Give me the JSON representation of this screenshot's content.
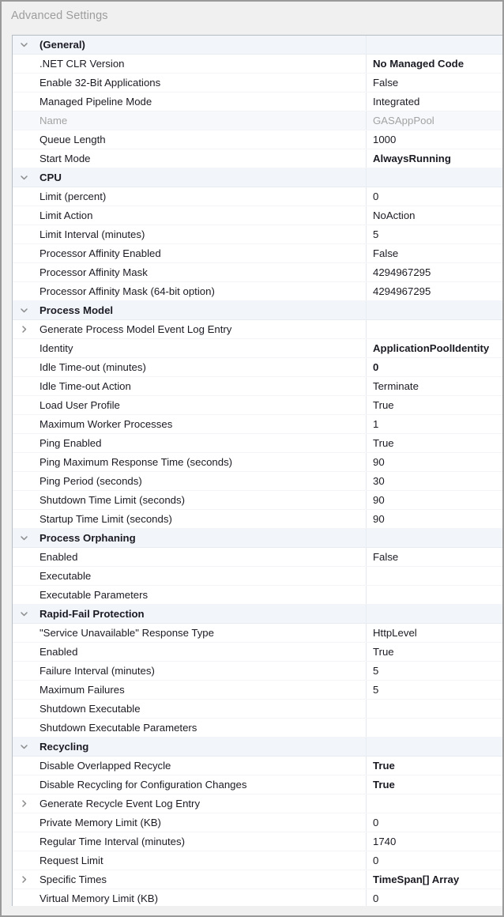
{
  "window": {
    "title": "Advanced Settings"
  },
  "icons": {
    "expanded": "chevron-down-icon",
    "collapsed": "chevron-right-icon"
  },
  "colors": {
    "dialog_background": "#f0f0f0",
    "dialog_border": "#9a9a9a",
    "panel_background": "#ffffff",
    "panel_border": "#b5bcc4",
    "section_header_background": "#f2f5fa",
    "row_separator": "#f3f4f7",
    "text": "#1b1b24",
    "disabled_text": "#a3a3a3",
    "title_text": "#9d9d9d"
  },
  "grid": {
    "rows": [
      {
        "kind": "section",
        "expander": "expanded",
        "label": "(General)",
        "value": ""
      },
      {
        "kind": "property",
        "expander": "none",
        "label": ".NET CLR Version",
        "value": "No Managed Code",
        "bold": true
      },
      {
        "kind": "property",
        "expander": "none",
        "label": "Enable 32-Bit Applications",
        "value": "False"
      },
      {
        "kind": "property",
        "expander": "none",
        "label": "Managed Pipeline Mode",
        "value": "Integrated"
      },
      {
        "kind": "property",
        "expander": "none",
        "label": "Name",
        "value": "GASAppPool",
        "disabled": true
      },
      {
        "kind": "property",
        "expander": "none",
        "label": "Queue Length",
        "value": "1000"
      },
      {
        "kind": "property",
        "expander": "none",
        "label": "Start Mode",
        "value": "AlwaysRunning",
        "bold": true
      },
      {
        "kind": "section",
        "expander": "expanded",
        "label": "CPU",
        "value": ""
      },
      {
        "kind": "property",
        "expander": "none",
        "label": "Limit (percent)",
        "value": "0"
      },
      {
        "kind": "property",
        "expander": "none",
        "label": "Limit Action",
        "value": "NoAction"
      },
      {
        "kind": "property",
        "expander": "none",
        "label": "Limit Interval (minutes)",
        "value": "5"
      },
      {
        "kind": "property",
        "expander": "none",
        "label": "Processor Affinity Enabled",
        "value": "False"
      },
      {
        "kind": "property",
        "expander": "none",
        "label": "Processor Affinity Mask",
        "value": "4294967295"
      },
      {
        "kind": "property",
        "expander": "none",
        "label": "Processor Affinity Mask (64-bit option)",
        "value": "4294967295"
      },
      {
        "kind": "section",
        "expander": "expanded",
        "label": "Process Model",
        "value": ""
      },
      {
        "kind": "property",
        "expander": "collapsed",
        "label": "Generate Process Model Event Log Entry",
        "value": ""
      },
      {
        "kind": "property",
        "expander": "none",
        "label": "Identity",
        "value": "ApplicationPoolIdentity",
        "bold": true
      },
      {
        "kind": "property",
        "expander": "none",
        "label": "Idle Time-out (minutes)",
        "value": "0",
        "bold": true
      },
      {
        "kind": "property",
        "expander": "none",
        "label": "Idle Time-out Action",
        "value": "Terminate"
      },
      {
        "kind": "property",
        "expander": "none",
        "label": "Load User Profile",
        "value": "True"
      },
      {
        "kind": "property",
        "expander": "none",
        "label": "Maximum Worker Processes",
        "value": "1"
      },
      {
        "kind": "property",
        "expander": "none",
        "label": "Ping Enabled",
        "value": "True"
      },
      {
        "kind": "property",
        "expander": "none",
        "label": "Ping Maximum Response Time (seconds)",
        "value": "90"
      },
      {
        "kind": "property",
        "expander": "none",
        "label": "Ping Period (seconds)",
        "value": "30"
      },
      {
        "kind": "property",
        "expander": "none",
        "label": "Shutdown Time Limit (seconds)",
        "value": "90"
      },
      {
        "kind": "property",
        "expander": "none",
        "label": "Startup Time Limit (seconds)",
        "value": "90"
      },
      {
        "kind": "section",
        "expander": "expanded",
        "label": "Process Orphaning",
        "value": ""
      },
      {
        "kind": "property",
        "expander": "none",
        "label": "Enabled",
        "value": "False"
      },
      {
        "kind": "property",
        "expander": "none",
        "label": "Executable",
        "value": ""
      },
      {
        "kind": "property",
        "expander": "none",
        "label": "Executable Parameters",
        "value": ""
      },
      {
        "kind": "section",
        "expander": "expanded",
        "label": "Rapid-Fail Protection",
        "value": ""
      },
      {
        "kind": "property",
        "expander": "none",
        "label": "\"Service Unavailable\" Response Type",
        "value": "HttpLevel"
      },
      {
        "kind": "property",
        "expander": "none",
        "label": "Enabled",
        "value": "True"
      },
      {
        "kind": "property",
        "expander": "none",
        "label": "Failure Interval (minutes)",
        "value": "5"
      },
      {
        "kind": "property",
        "expander": "none",
        "label": "Maximum Failures",
        "value": "5"
      },
      {
        "kind": "property",
        "expander": "none",
        "label": "Shutdown Executable",
        "value": ""
      },
      {
        "kind": "property",
        "expander": "none",
        "label": "Shutdown Executable Parameters",
        "value": ""
      },
      {
        "kind": "section",
        "expander": "expanded",
        "label": "Recycling",
        "value": ""
      },
      {
        "kind": "property",
        "expander": "none",
        "label": "Disable Overlapped Recycle",
        "value": "True",
        "bold": true
      },
      {
        "kind": "property",
        "expander": "none",
        "label": "Disable Recycling for Configuration Changes",
        "value": "True",
        "bold": true
      },
      {
        "kind": "property",
        "expander": "collapsed",
        "label": "Generate Recycle Event Log Entry",
        "value": ""
      },
      {
        "kind": "property",
        "expander": "none",
        "label": "Private Memory Limit (KB)",
        "value": "0"
      },
      {
        "kind": "property",
        "expander": "none",
        "label": "Regular Time Interval (minutes)",
        "value": "1740"
      },
      {
        "kind": "property",
        "expander": "none",
        "label": "Request Limit",
        "value": "0"
      },
      {
        "kind": "property",
        "expander": "collapsed",
        "label": "Specific Times",
        "value": "TimeSpan[] Array",
        "bold": true
      },
      {
        "kind": "property",
        "expander": "none",
        "label": "Virtual Memory Limit (KB)",
        "value": "0"
      }
    ]
  }
}
